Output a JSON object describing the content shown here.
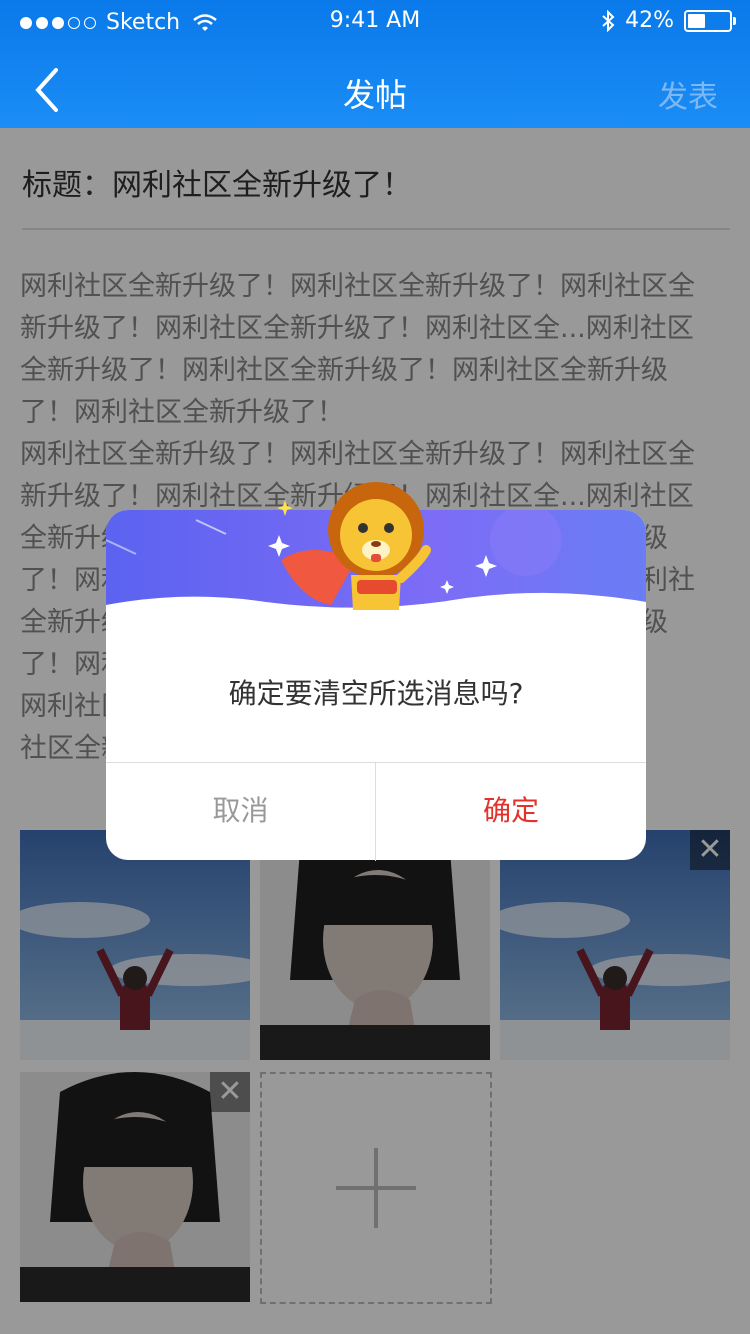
{
  "status_bar": {
    "carrier": "Sketch",
    "time": "9:41 AM",
    "battery_pct": "42%",
    "battery_level": 0.42
  },
  "nav": {
    "title": "发帖",
    "action": "发表"
  },
  "post": {
    "title_label": "标题：",
    "title": "网利社区全新升级了！",
    "body": "网利社区全新升级了！网利社区全新升级了！网利社区全\n新升级了！网利社区全新升级了！网利社区全...网利社区\n全新升级了！网利社区全新升级了！网利社区全新升级\n了！网利社区全新升级了！\n网利社区全新升级了！网利社区全新升级了！网利社区全\n新升级了！网利社区全新升级了！网利社区全...网利社区\n全新升级了！网利社区全新升级了！网利社区全新升级\n了！网利社区全新升级了！网利社区全新升级了！网利社\n全新升级了！网利社区全新升级了！网利社区全新升级\n了！网利社区全新升级了！网利社区全新升级了！\n网利社区全新升级了！网利社区全新升级了！网利\n社区全新升级了！"
  },
  "images": [
    {
      "kind": "sky"
    },
    {
      "kind": "portrait"
    },
    {
      "kind": "sky"
    },
    {
      "kind": "portrait"
    }
  ],
  "dialog": {
    "message": "确定要清空所选消息吗?",
    "cancel": "取消",
    "confirm": "确定",
    "accent": "#e2322b"
  },
  "icons": {
    "back": "chevron-left-icon",
    "close": "close-icon",
    "add": "plus-icon"
  },
  "close_glyph": "✕"
}
